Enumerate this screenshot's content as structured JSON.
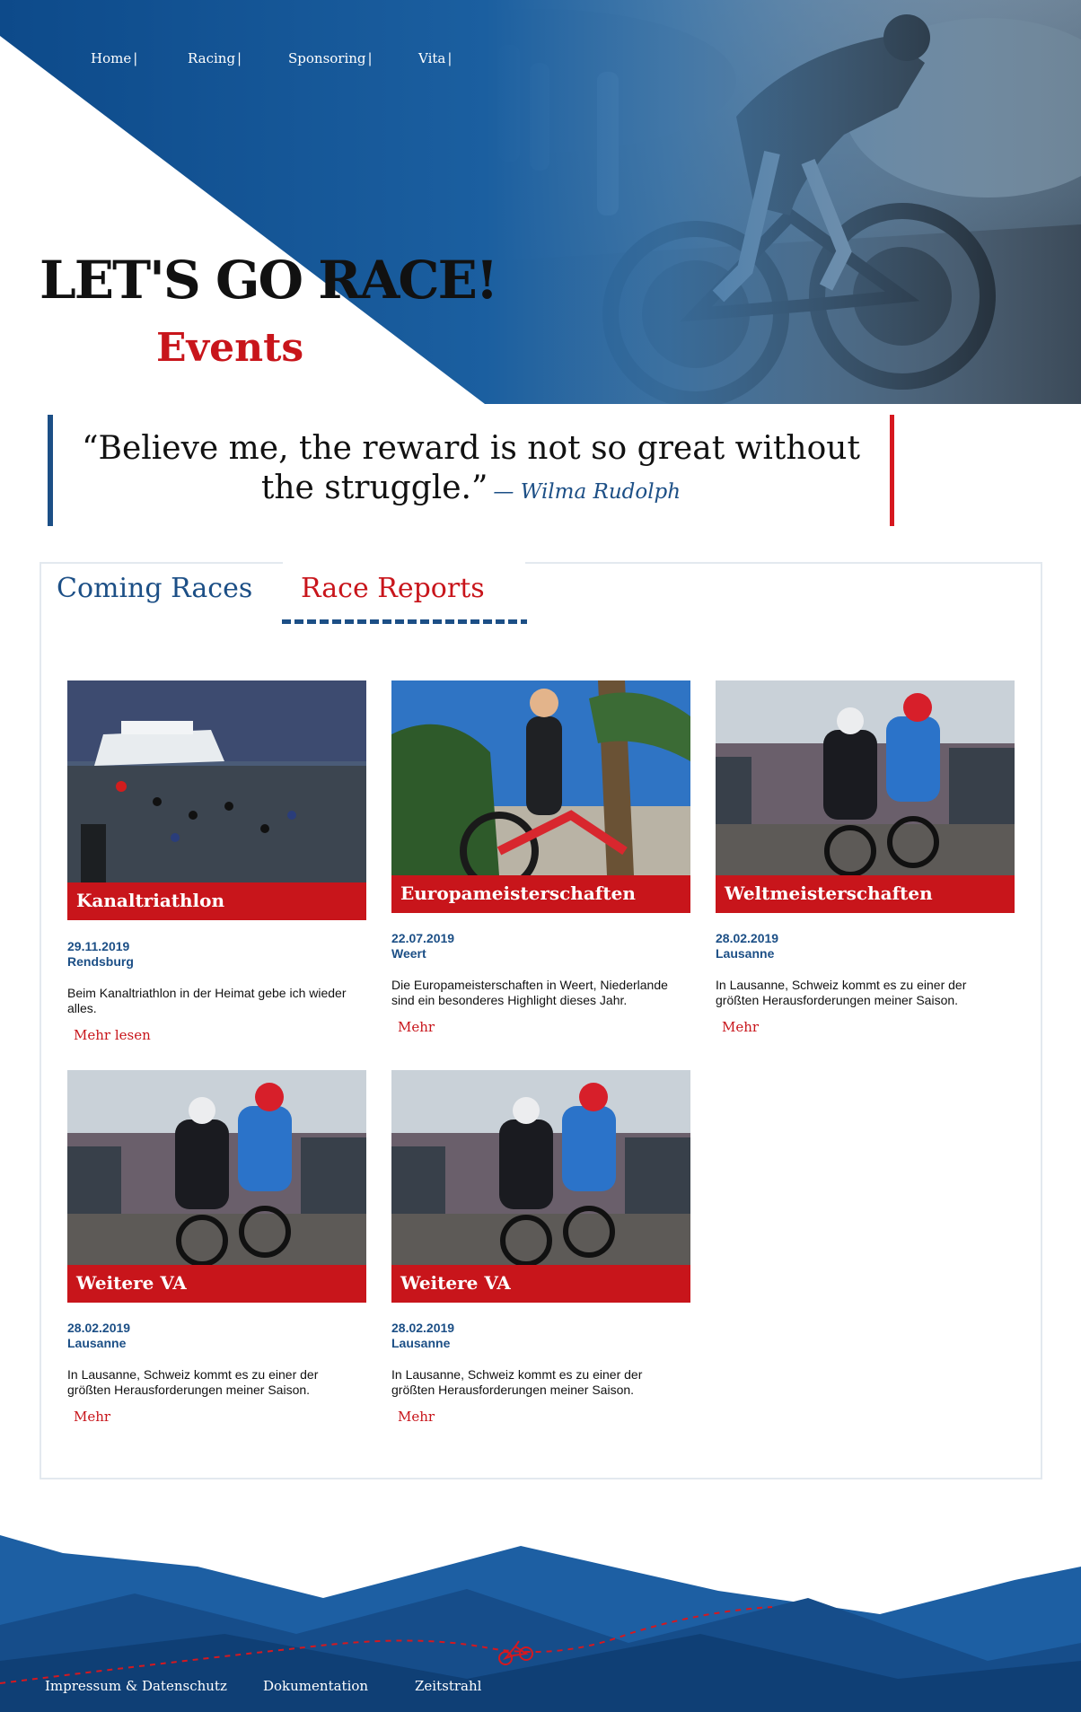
{
  "nav": {
    "items": [
      {
        "label": "Home",
        "sep": "|"
      },
      {
        "label": "Racing",
        "sep": "|"
      },
      {
        "label": "Sponsoring",
        "sep": "|"
      },
      {
        "label": "Vita",
        "sep": "|"
      }
    ]
  },
  "hero": {
    "title": "LET'S GO RACE!",
    "subtitle": "Events"
  },
  "quote": {
    "text": "“Believe me, the reward is not so great without the struggle.”",
    "author": "— Wilma Rudolph"
  },
  "tabs": {
    "coming": "Coming Races",
    "reports": "Race Reports"
  },
  "cards": [
    {
      "title": "Kanaltriathlon",
      "date": "29.11.2019",
      "place": "Rendsburg",
      "desc": "Beim Kanaltriathlon in der Heimat gebe ich wieder alles.",
      "more": "Mehr lesen"
    },
    {
      "title": "Europameisterschaften",
      "date": "22.07.2019",
      "place": "Weert",
      "desc": "Die Europameisterschaften in Weert, Niederlande sind ein besonderes Highlight dieses Jahr.",
      "more": "Mehr"
    },
    {
      "title": "Weltmeisterschaften",
      "date": "28.02.2019",
      "place": "Lausanne",
      "desc": "In Lausanne, Schweiz kommt es zu einer der größten Herausforderungen meiner Saison.",
      "more": "Mehr"
    },
    {
      "title": "Weitere VA",
      "date": "28.02.2019",
      "place": "Lausanne",
      "desc": "In Lausanne, Schweiz kommt es zu einer der größten Herausforderungen meiner Saison.",
      "more": "Mehr"
    },
    {
      "title": "Weitere VA",
      "date": "28.02.2019",
      "place": "Lausanne",
      "desc": "In Lausanne, Schweiz kommt es zu einer der größten Herausforderungen meiner Saison.",
      "more": "Mehr"
    }
  ],
  "footer": {
    "links": [
      "Impressum & Datenschutz",
      "Dokumentation",
      "Zeitstrahl"
    ]
  },
  "colors": {
    "brand_blue": "#1c4f86",
    "accent_red": "#c8151b"
  }
}
